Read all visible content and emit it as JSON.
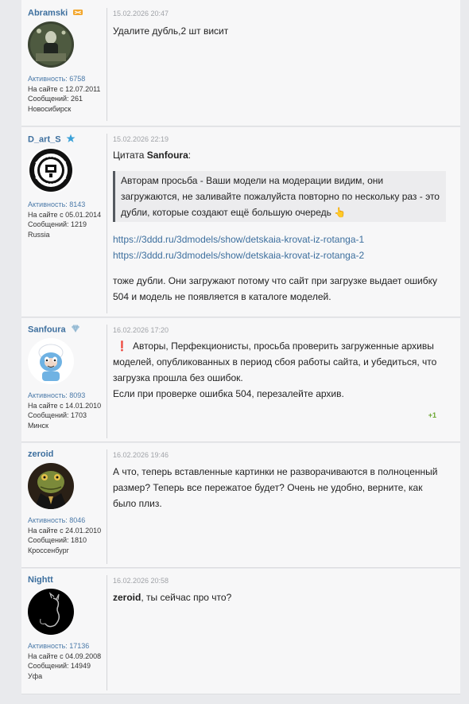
{
  "posts": [
    {
      "username": "Abramski",
      "badge_icon": "rank-badge-icon",
      "activity": "Активность: 6758",
      "since": "На сайте с 12.07.2011",
      "messages": "Сообщений: 261",
      "location": "Новосибирск",
      "date": "15.02.2026 20:47",
      "text": "Удалите дубль,2 шт висит"
    },
    {
      "username": "D_art_S",
      "badge_icon": "star-icon",
      "activity": "Активность: 8143",
      "since": "На сайте с 05.01.2014",
      "messages": "Сообщений: 1219",
      "location": "Russia",
      "date": "15.02.2026 22:19",
      "quote_prefix": "Цитата ",
      "quote_author": "Sanfoura",
      "quote_suffix": ":",
      "quote_text": "Авторам просьба - Ваши модели на модерации видим, они загружаются, не заливайте пожалуйста повторно по нескольку раз - это дубли, которые создают ещё большую очередь",
      "link1": "https://3ddd.ru/3dmodels/show/detskaia-krovat-iz-rotanga-1",
      "link2": "https://3ddd.ru/3dmodels/show/detskaia-krovat-iz-rotanga-2",
      "text": "тоже дубли. Они загружают потому что сайт при загрузке выдает ошибку 504 и модель не появляется в каталоге моделей."
    },
    {
      "username": "Sanfoura",
      "badge_icon": "diamond-icon",
      "activity": "Активность: 8093",
      "since": "На сайте с 14.01.2010",
      "messages": "Сообщений: 1703",
      "location": "Минск",
      "date": "16.02.2026 17:20",
      "alert": "❗",
      "text": "Авторы, Перфекционисты, просьба проверить загруженные архивы моделей, опубликованных в период сбоя работы сайта, и убедиться, что загрузка прошла без ошибок.",
      "text2": "Если при проверке ошибка 504, перезалейте архив.",
      "rating": "+1"
    },
    {
      "username": "zeroid",
      "activity": "Активность: 8046",
      "since": "На сайте с 24.01.2010",
      "messages": "Сообщений: 1810",
      "location": "Кроссенбург",
      "date": "16.02.2026 19:46",
      "text": "А что, теперь вставленные картинки не разворачиваются в полноценный размер? Теперь все пережатое будет? Очень не удобно, верните, как было плиз."
    },
    {
      "username": "Nightt",
      "activity": "Активность: 17136",
      "since": "На сайте с 04.09.2008",
      "messages": "Сообщений: 14949",
      "location": "Уфа",
      "date": "16.02.2026 20:58",
      "mention": "zeroid",
      "text": ", ты сейчас про что?"
    }
  ]
}
